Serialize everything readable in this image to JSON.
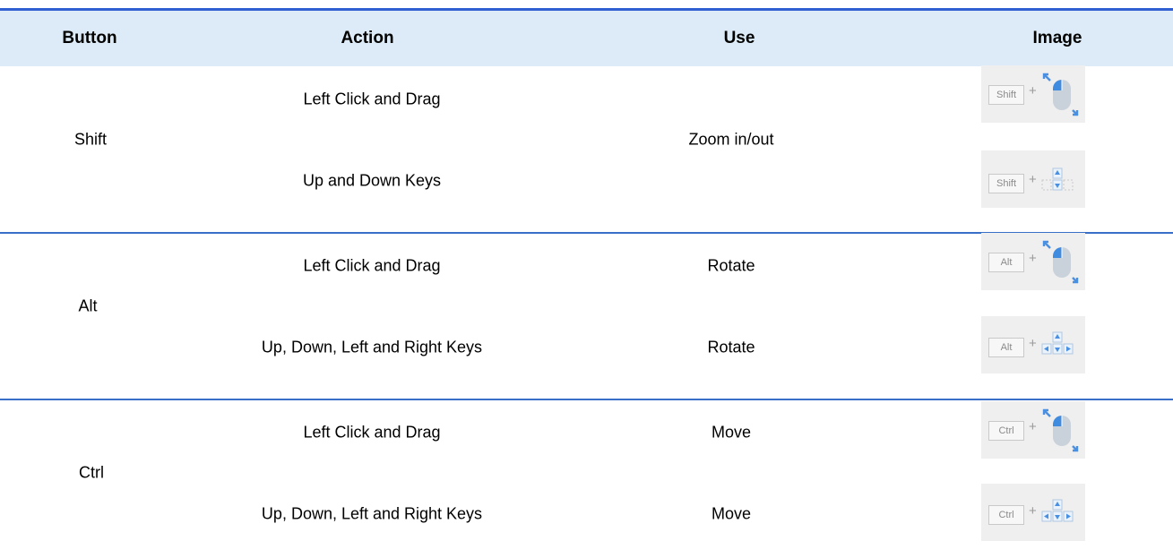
{
  "table": {
    "headers": [
      "Button",
      "Action",
      "Use",
      "Image"
    ],
    "groups": [
      {
        "button": "Shift",
        "use_merged": "Zoom in/out",
        "rows": [
          {
            "action": "Left Click and Drag",
            "use": "",
            "image": {
              "key": "Shift",
              "plus": "+",
              "icon": "mouse-left-drag-icon"
            }
          },
          {
            "action": "Up and Down Keys",
            "use": "",
            "image": {
              "key": "Shift",
              "plus": "+",
              "icon": "arrow-keys-updown-icon"
            }
          }
        ]
      },
      {
        "button": "Alt",
        "use_merged": "",
        "rows": [
          {
            "action": "Left Click and Drag",
            "use": "Rotate",
            "image": {
              "key": "Alt",
              "plus": "+",
              "icon": "mouse-left-drag-icon"
            }
          },
          {
            "action": "Up, Down, Left and Right Keys",
            "use": "Rotate",
            "image": {
              "key": "Alt",
              "plus": "+",
              "icon": "arrow-keys-all-icon"
            }
          }
        ]
      },
      {
        "button": "Ctrl",
        "use_merged": "",
        "rows": [
          {
            "action": "Left Click and Drag",
            "use": "Move",
            "image": {
              "key": "Ctrl",
              "plus": "+",
              "icon": "mouse-left-drag-icon"
            }
          },
          {
            "action": "Up, Down, Left and Right Keys",
            "use": "Move",
            "image": {
              "key": "Ctrl",
              "plus": "+",
              "icon": "arrow-keys-all-icon"
            }
          }
        ]
      }
    ]
  },
  "colors": {
    "header_bg": "#dcebf7",
    "rule": "#3a6fc8",
    "accent": "#4a90e2"
  }
}
